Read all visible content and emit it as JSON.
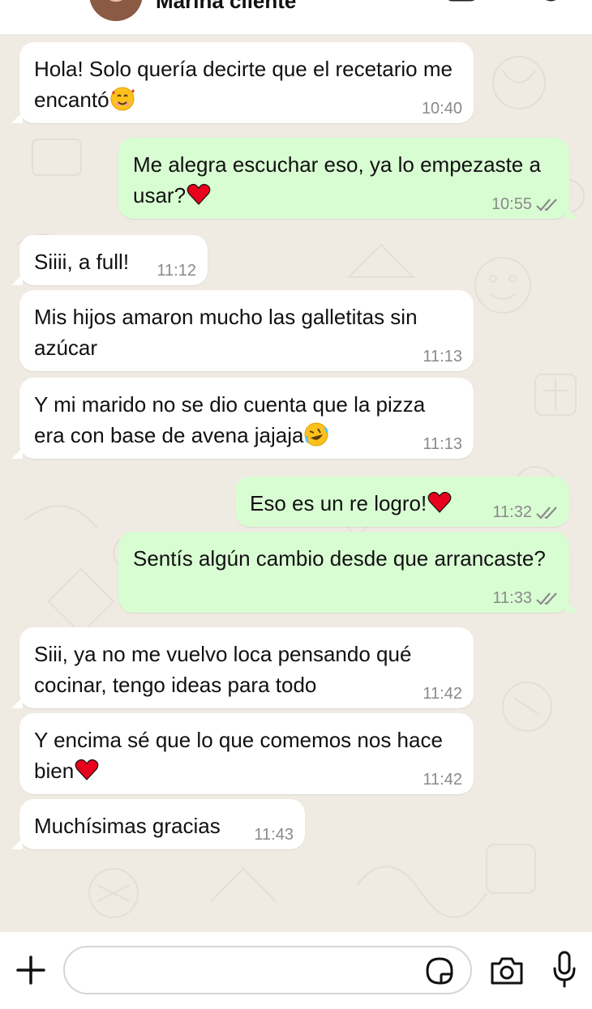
{
  "header": {
    "contact_name": "Marina cliente"
  },
  "messages": [
    {
      "dir": "in",
      "text": "Hola! Solo quería decirte que el recetario me encantó",
      "emoji": "smiling-face-with-hearts",
      "time": "10:40"
    },
    {
      "dir": "out",
      "text": "Me alegra escuchar eso, ya lo empezaste a usar?",
      "emoji": "red-heart",
      "time": "10:55",
      "status": "read"
    },
    {
      "dir": "in",
      "text": "Siiii, a full!",
      "time": "11:12"
    },
    {
      "dir": "in",
      "text": "Mis hijos amaron mucho las galletitas sin azúcar",
      "time": "11:13"
    },
    {
      "dir": "in",
      "text": "Y mi marido no se dio cuenta que la pizza era con base de avena jajaja",
      "emoji": "rolling-on-floor-laughing",
      "time": "11:13"
    },
    {
      "dir": "out",
      "text": "Eso es un re logro!",
      "emoji": "red-heart",
      "time": "11:32",
      "status": "read"
    },
    {
      "dir": "out",
      "text": "Sentís algún cambio desde que arrancaste?",
      "time": "11:33",
      "status": "read"
    },
    {
      "dir": "in",
      "text": "Siii, ya no me vuelvo loca pensando qué cocinar, tengo ideas para todo",
      "time": "11:42"
    },
    {
      "dir": "in",
      "text": "Y encima sé que lo que comemos nos hace bien",
      "emoji": "red-heart",
      "time": "11:42"
    },
    {
      "dir": "in",
      "text": "Muchísimas gracias",
      "time": "11:43"
    }
  ],
  "input": {
    "placeholder": ""
  },
  "colors": {
    "incoming_bubble": "#ffffff",
    "outgoing_bubble": "#d9fdd3",
    "chat_background": "#efeae2",
    "read_ticks": "#8a8a8a"
  }
}
